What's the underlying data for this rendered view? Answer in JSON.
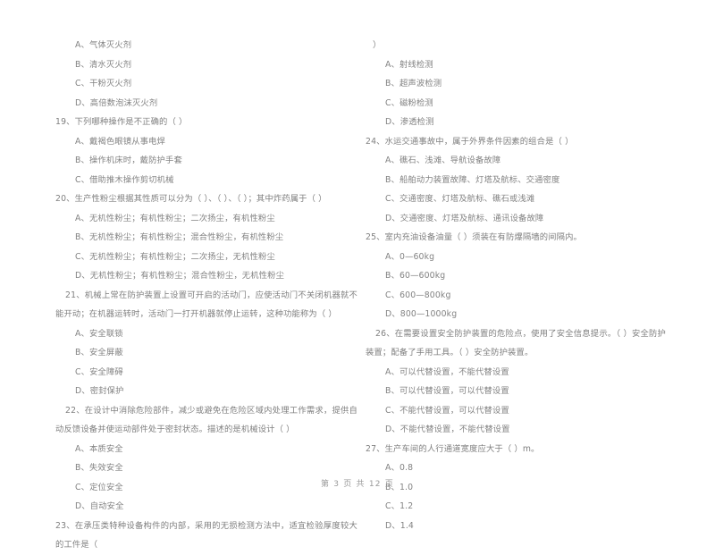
{
  "document": {
    "type": "exam-paper-scan",
    "footer": "第 3 页 共 12 页",
    "ink_color": "#808080",
    "background_color": "#ffffff"
  },
  "left_column": {
    "carryover_options": [
      "A、气体灭火剂",
      "B、清水灭火剂",
      "C、干粉灭火剂",
      "D、高倍数泡沫灭火剂"
    ],
    "questions": [
      {
        "number": "19、",
        "stem": "下列哪种操作是不正确的（      ）",
        "options": [
          "A、戴褐色眼镜从事电焊",
          "B、操作机床时，戴防护手套",
          "C、借助推木操作剪切机械"
        ]
      },
      {
        "number": "20、",
        "stem": "生产性粉尘根据其性质可以分为（      ）、（      ）、（      ）；其中炸药属于（      ）",
        "options": [
          "A、无机性粉尘；有机性粉尘；二次扬尘，有机性粉尘",
          "B、无机性粉尘；有机性粉尘；混合性粉尘，有机性粉尘",
          "C、无机性粉尘；有机性粉尘；二次扬尘，无机性粉尘",
          "D、无机性粉尘；有机性粉尘；混合性粉尘，无机性粉尘"
        ]
      },
      {
        "number": "21、",
        "stem": "机械上常在防护装置上设置可开启的活动门，应使活动门不关闭机器就不能开动；在机器运转时，活动门一打开机器就停止运转，这种功能称为（      ）",
        "options": [
          "A、安全联锁",
          "B、安全屏蔽",
          "C、安全障碍",
          "D、密封保护"
        ]
      },
      {
        "number": "22、",
        "stem": "在设计中消除危险部件，减少或避免在危险区域内处理工作需求，提供自动反馈设备并使运动部件处于密封状态。描述的是机械设计（      ）",
        "options": [
          "A、本质安全",
          "B、失效安全",
          "C、定位安全",
          "D、自动安全"
        ]
      },
      {
        "number": "23、",
        "stem": "在承压类特种设备构件的内部，采用的无损检测方法中，适宜检验厚度较大的工件是（",
        "options": []
      }
    ]
  },
  "right_column": {
    "carryover_stem_tail": "）",
    "carryover_options": [
      "A、射线检测",
      "B、超声波检测",
      "C、磁粉检测",
      "D、渗透检测"
    ],
    "questions": [
      {
        "number": "24、",
        "stem": "水运交通事故中，属于外界条件因素的组合是（      ）",
        "options": [
          "A、礁石、浅滩、导航设备故障",
          "B、船舶动力装置故障、灯塔及航标、交通密度",
          "C、交通密度、灯塔及航标、礁石或浅滩",
          "D、交通密度、灯塔及航标、通讯设备故障"
        ]
      },
      {
        "number": "25、",
        "stem": "室内充油设备油量（      ）须装在有防爆隔墙的间隔内。",
        "options": [
          "A、0—60kg",
          "B、60—600kg",
          "C、600—800kg",
          "D、800—1000kg"
        ]
      },
      {
        "number": "26、",
        "stem": "在需要设置安全防护装置的危险点，使用了安全信息提示。（      ）安全防护装置；配备了手用工具。（      ）安全防护装置。",
        "options": [
          "A、可以代替设置，不能代替设置",
          "B、可以代替设置，可以代替设置",
          "C、不能代替设置，可以代替设置",
          "D、不能代替设置，不能代替设置"
        ]
      },
      {
        "number": "27、",
        "stem": "生产车间的人行通道宽度应大于（      ）m。",
        "options": [
          "A、0.8",
          "B、1.0",
          "C、1.2",
          "D、1.4"
        ]
      }
    ]
  }
}
